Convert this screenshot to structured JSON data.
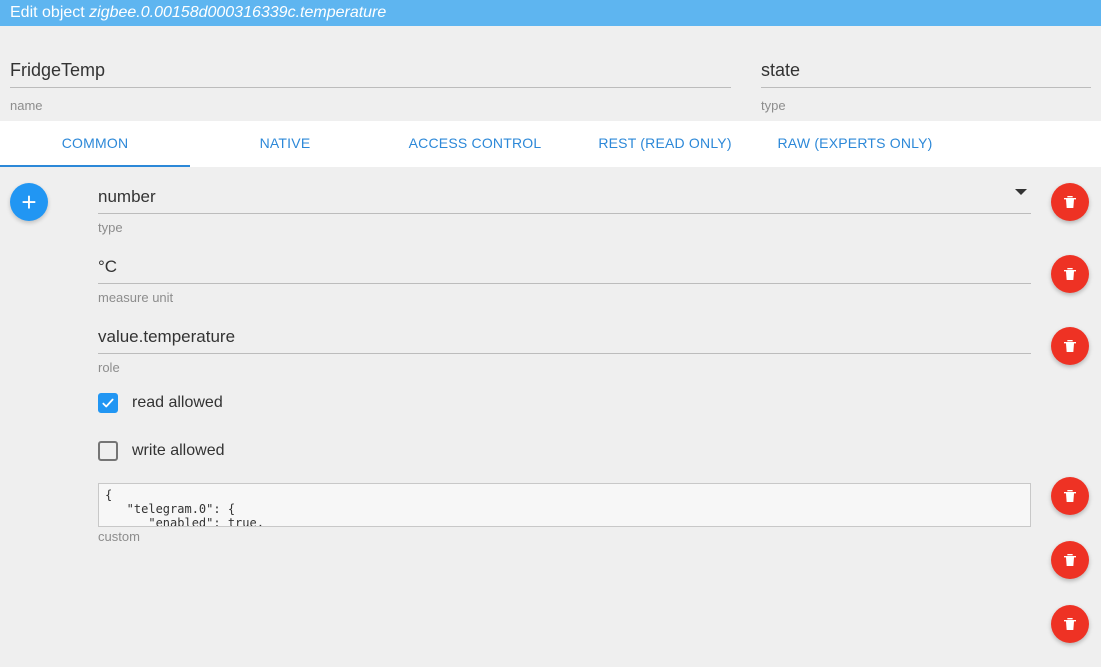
{
  "title": {
    "prefix": "Edit object ",
    "object_id": "zigbee.0.00158d000316339c.temperature"
  },
  "header": {
    "name": {
      "value": "FridgeTemp",
      "label": "name"
    },
    "type": {
      "value": "state",
      "label": "type"
    }
  },
  "tabs": [
    "COMMON",
    "NATIVE",
    "ACCESS CONTROL",
    "REST (READ ONLY)",
    "RAW (EXPERTS ONLY)"
  ],
  "active_tab": 0,
  "common": {
    "type": {
      "value": "number",
      "label": "type"
    },
    "unit": {
      "value": "°C",
      "label": "measure unit"
    },
    "role": {
      "value": "value.temperature",
      "label": "role"
    },
    "read": {
      "checked": true,
      "label": "read allowed"
    },
    "write": {
      "checked": false,
      "label": "write allowed"
    },
    "custom": {
      "label": "custom",
      "json": "{\n   \"telegram.0\": {\n      \"enabled\": true,"
    }
  }
}
